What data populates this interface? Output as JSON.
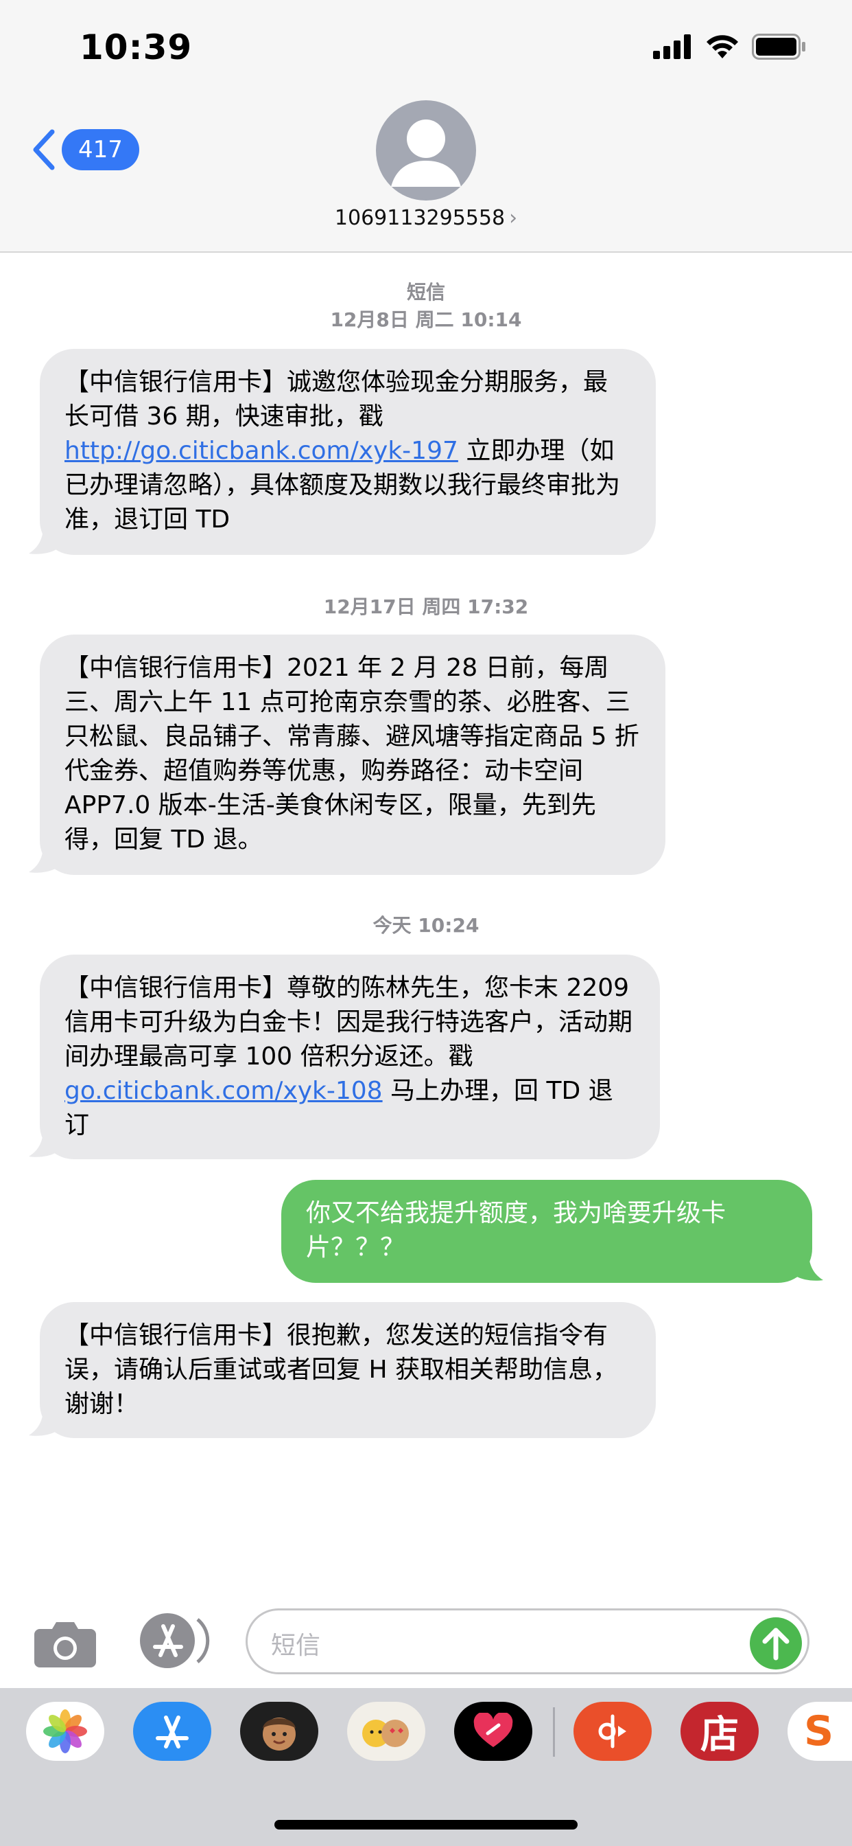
{
  "status_bar": {
    "time": "10:39"
  },
  "header": {
    "back_badge": "417",
    "contact_number": "1069113295558",
    "contact_arrow": "›"
  },
  "thread": {
    "service_label": "短信",
    "messages": [
      {
        "timestamp": "12月8日 周二 10:14"
      },
      {
        "timestamp": "12月17日 周四 17:32"
      },
      {
        "timestamp": "今天 10:24"
      }
    ],
    "msg1": {
      "part1": "【中信银行信用卡】诚邀您体验现金分期服务，最长可借 36 期，快速审批，戳 ",
      "link": "http://go.citicbank.com/xyk-197",
      "part2": " 立即办理（如已办理请忽略），具体额度及期数以我行最终审批为准，退订回 TD"
    },
    "msg2": {
      "text": "【中信银行信用卡】2021 年 2 月 28 日前，每周三、周六上午 11 点可抢南京奈雪的茶、必胜客、三只松鼠、良品铺子、常青藤、避风塘等指定商品 5 折代金券、超值购券等优惠，购券路径：动卡空间 APP7.0 版本-生活-美食休闲专区，限量，先到先得，回复 TD 退。"
    },
    "msg3": {
      "part1": "【中信银行信用卡】尊敬的陈林先生，您卡末 2209 信用卡可升级为白金卡！因是我行特选客户，活动期间办理最高可享 100 倍积分返还。戳 ",
      "link": "go.citicbank.com/xyk-108",
      "part2": " 马上办理，回 TD 退订"
    },
    "msg4": {
      "text": "你又不给我提升额度，我为啥要升级卡片？？？"
    },
    "msg5": {
      "text": "【中信银行信用卡】很抱歉，您发送的短信指令有误，请确认后重试或者回复 H 获取相关帮助信息，谢谢！"
    }
  },
  "input": {
    "placeholder": "短信"
  },
  "apps": [
    {
      "icon": "photos-icon"
    },
    {
      "icon": "app-store-icon"
    },
    {
      "icon": "memoji-icon"
    },
    {
      "icon": "memoji-stickers-icon"
    },
    {
      "icon": "digital-touch-icon"
    },
    {
      "icon": "music-app-icon"
    },
    {
      "icon": "store-app-icon",
      "label": "店"
    },
    {
      "icon": "sogou-app-icon",
      "label": "S"
    }
  ],
  "colors": {
    "accent": "#3478f6",
    "incoming": "#e9e9eb",
    "outgoing": "#65c466",
    "link": "#2f6fe4"
  }
}
